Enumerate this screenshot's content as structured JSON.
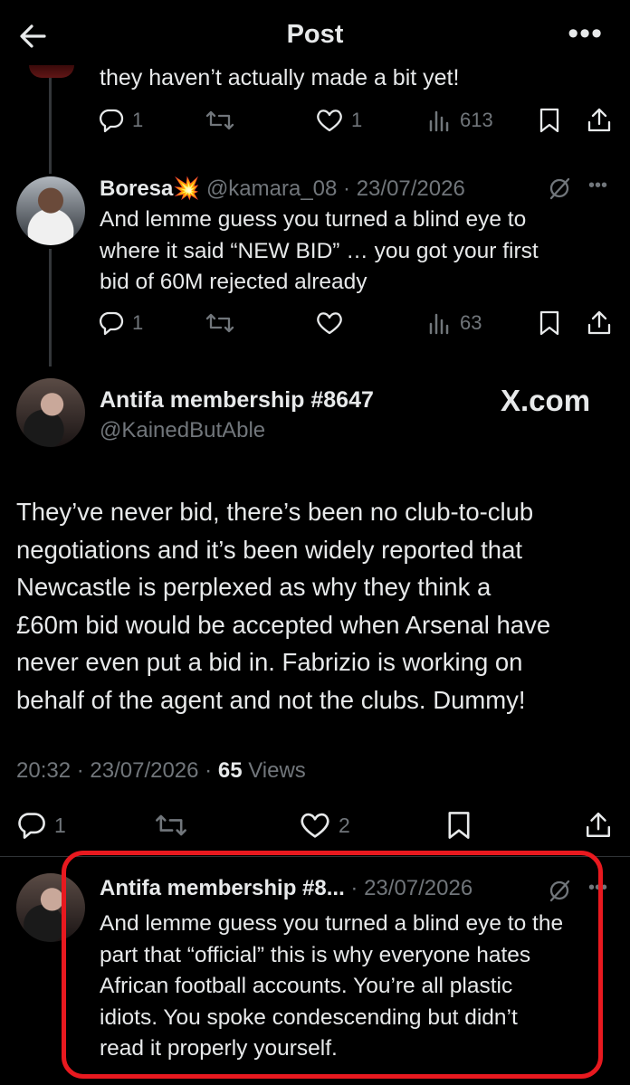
{
  "header": {
    "title": "Post"
  },
  "tweet1": {
    "text": "they haven’t actually made a bit yet!",
    "replies": "1",
    "likes": "1",
    "views": "613"
  },
  "tweet2": {
    "name": "Boresa",
    "emoji": "💥",
    "handle": "@kamara_08",
    "date": "· 23/07/2026",
    "lines": [
      "And lemme guess you turned a blind eye to",
      "where it said “NEW BID” … you got your first",
      "bid of 60M rejected already"
    ],
    "replies": "1",
    "views": "63"
  },
  "main": {
    "name": "Antifa membership #8647",
    "handle": "@KainedButAble",
    "watermark": "X.com",
    "lines": [
      "They’ve never bid, there’s been no club-to-club",
      "negotiations and it’s been widely reported that",
      "Newcastle is perplexed as why they think a",
      "£60m bid would be accepted when Arsenal have",
      "never even put a bid in. Fabrizio is working on",
      "behalf of the agent and not the clubs. Dummy!"
    ],
    "time": "20:32 · 23/07/2026 ·",
    "views_count": "65",
    "views_label": "Views",
    "replies": "1",
    "likes": "2"
  },
  "reply": {
    "name": "Antifa membership #8...",
    "date": "· 23/07/2026",
    "lines": [
      "And lemme guess you turned a blind eye to the",
      "part that “official” this is why everyone hates",
      "African football accounts. You’re all plastic",
      "idiots. You spoke condescending but didn’t",
      "read it properly yourself."
    ]
  },
  "colors": {
    "background": "#000000",
    "text": "#e7e9ea",
    "muted": "#71767b",
    "highlight": "#e8191f"
  }
}
